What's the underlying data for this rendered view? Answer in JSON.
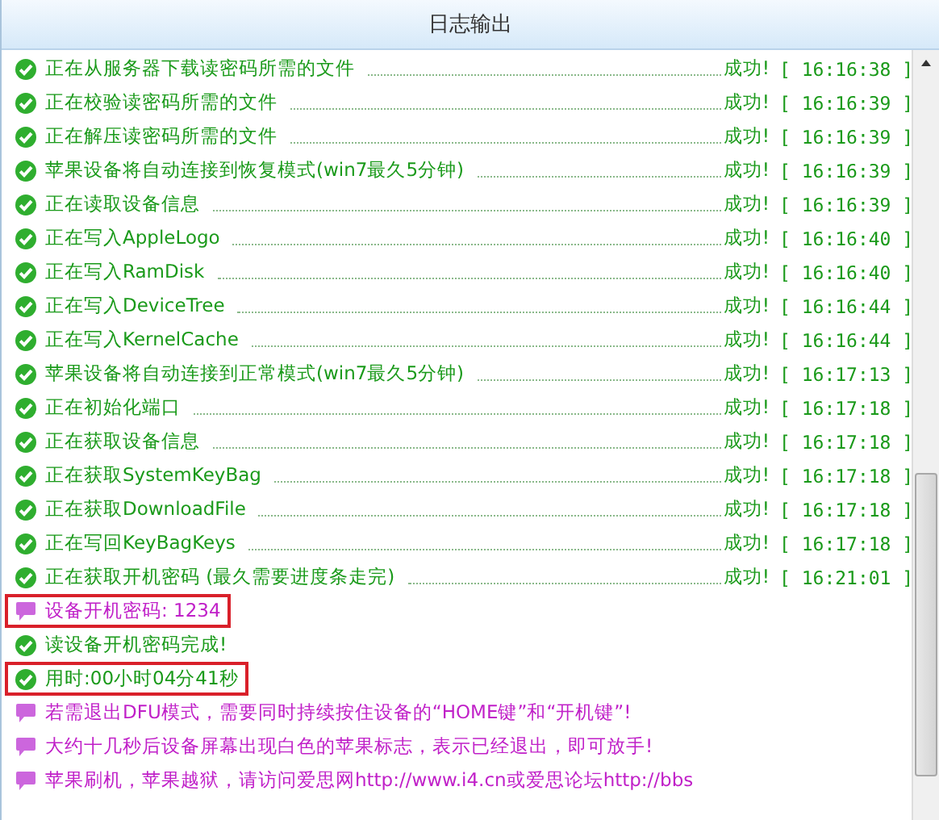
{
  "panel": {
    "title": "日志输出"
  },
  "log": [
    {
      "kind": "success",
      "message": "正在从服务器下载读密码所需的文件",
      "result": "成功!",
      "time": "[ 16:16:38 ]",
      "highlighted": false
    },
    {
      "kind": "success",
      "message": "正在校验读密码所需的文件",
      "result": "成功!",
      "time": "[ 16:16:39 ]",
      "highlighted": false
    },
    {
      "kind": "success",
      "message": "正在解压读密码所需的文件",
      "result": "成功!",
      "time": "[ 16:16:39 ]",
      "highlighted": false
    },
    {
      "kind": "success",
      "message": "苹果设备将自动连接到恢复模式(win7最久5分钟)",
      "result": "成功!",
      "time": "[ 16:16:39 ]",
      "highlighted": false
    },
    {
      "kind": "success",
      "message": "正在读取设备信息",
      "result": "成功!",
      "time": "[ 16:16:39 ]",
      "highlighted": false
    },
    {
      "kind": "success",
      "message": "正在写入AppleLogo",
      "result": "成功!",
      "time": "[ 16:16:40 ]",
      "highlighted": false
    },
    {
      "kind": "success",
      "message": "正在写入RamDisk",
      "result": "成功!",
      "time": "[ 16:16:40 ]",
      "highlighted": false
    },
    {
      "kind": "success",
      "message": "正在写入DeviceTree",
      "result": "成功!",
      "time": "[ 16:16:44 ]",
      "highlighted": false
    },
    {
      "kind": "success",
      "message": "正在写入KernelCache",
      "result": "成功!",
      "time": "[ 16:16:44 ]",
      "highlighted": false
    },
    {
      "kind": "success",
      "message": "苹果设备将自动连接到正常模式(win7最久5分钟)",
      "result": "成功!",
      "time": "[ 16:17:13 ]",
      "highlighted": false
    },
    {
      "kind": "success",
      "message": "正在初始化端口",
      "result": "成功!",
      "time": "[ 16:17:18 ]",
      "highlighted": false
    },
    {
      "kind": "success",
      "message": "正在获取设备信息",
      "result": "成功!",
      "time": "[ 16:17:18 ]",
      "highlighted": false
    },
    {
      "kind": "success",
      "message": "正在获取SystemKeyBag",
      "result": "成功!",
      "time": "[ 16:17:18 ]",
      "highlighted": false
    },
    {
      "kind": "success",
      "message": "正在获取DownloadFile",
      "result": "成功!",
      "time": "[ 16:17:18 ]",
      "highlighted": false
    },
    {
      "kind": "success",
      "message": "正在写回KeyBagKeys",
      "result": "成功!",
      "time": "[ 16:17:18 ]",
      "highlighted": false
    },
    {
      "kind": "success",
      "message": "正在获取开机密码 (最久需要进度条走完)",
      "result": "成功!",
      "time": "[ 16:21:01 ]",
      "highlighted": false
    },
    {
      "kind": "info",
      "message": "设备开机密码: 1234",
      "highlighted": true
    },
    {
      "kind": "success",
      "message": "读设备开机密码完成!",
      "highlighted": false
    },
    {
      "kind": "success",
      "message": "用时:00小时04分41秒",
      "highlighted": true
    },
    {
      "kind": "info",
      "message": "若需退出DFU模式，需要同时持续按住设备的“HOME键”和“开机键”!",
      "highlighted": false
    },
    {
      "kind": "info",
      "message": "大约十几秒后设备屏幕出现白色的苹果标志，表示已经退出，即可放手!",
      "highlighted": false
    },
    {
      "kind": "info",
      "message": "苹果刷机，苹果越狱，请访问爱思网http://www.i4.cn或爱思论坛http://bbs",
      "highlighted": false
    }
  ]
}
